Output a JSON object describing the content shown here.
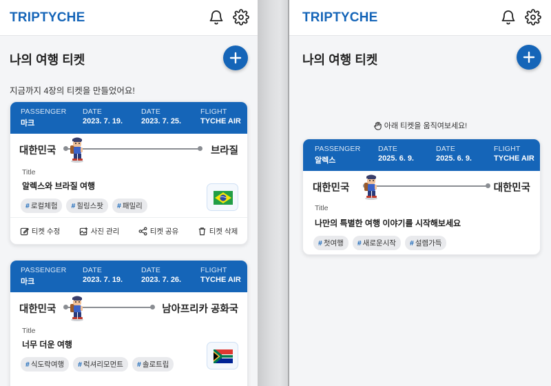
{
  "brand": "TRIPTYCHE",
  "section_title": "나의 여행 티켓",
  "add_button_icon": "plus-icon",
  "left": {
    "subtitle": "지금까지 4장의 티켓을 만들었어요!",
    "tickets": [
      {
        "passenger_label": "PASSENGER",
        "passenger": "마크",
        "date_label": "DATE",
        "date_start": "2023. 7. 19.",
        "date_end": "2023. 7. 25.",
        "flight_label": "FLIGHT",
        "flight": "TYCHE AIR",
        "from": "대한민국",
        "to": "브라질",
        "title_label": "Title",
        "title": "알렉스와 브라질 여행",
        "tags": [
          "로컬체험",
          "힐링스팟",
          "패밀리"
        ],
        "flag": "brazil-flag"
      },
      {
        "passenger_label": "PASSENGER",
        "passenger": "마크",
        "date_label": "DATE",
        "date_start": "2023. 7. 19.",
        "date_end": "2023. 7. 26.",
        "flight_label": "FLIGHT",
        "flight": "TYCHE AIR",
        "from": "대한민국",
        "to": "남아프리카 공화국",
        "title_label": "Title",
        "title": "너무 더운 여행",
        "tags": [
          "식도락여행",
          "럭셔리모먼트",
          "솔로트립"
        ],
        "flag": "south-africa-flag"
      }
    ],
    "actions": {
      "edit": "티켓 수정",
      "photos": "사진 관리",
      "share": "티켓 공유",
      "delete": "티켓 삭제"
    }
  },
  "right": {
    "hint": "아래 티켓을 움직여보세요!",
    "ticket": {
      "passenger_label": "PASSENGER",
      "passenger": "알렉스",
      "date_label": "DATE",
      "date_start": "2025. 6. 9.",
      "date_end": "2025. 6. 9.",
      "flight_label": "FLIGHT",
      "flight": "TYCHE AIR",
      "from": "대한민국",
      "to": "대한민국",
      "title_label": "Title",
      "title": "나만의 특별한 여행 이야기를 시작해보세요",
      "tags": [
        "첫여행",
        "새로운시작",
        "설렘가득"
      ]
    }
  },
  "colors": {
    "brand_blue": "#1565b8",
    "tag_bg": "#e9eaed"
  }
}
